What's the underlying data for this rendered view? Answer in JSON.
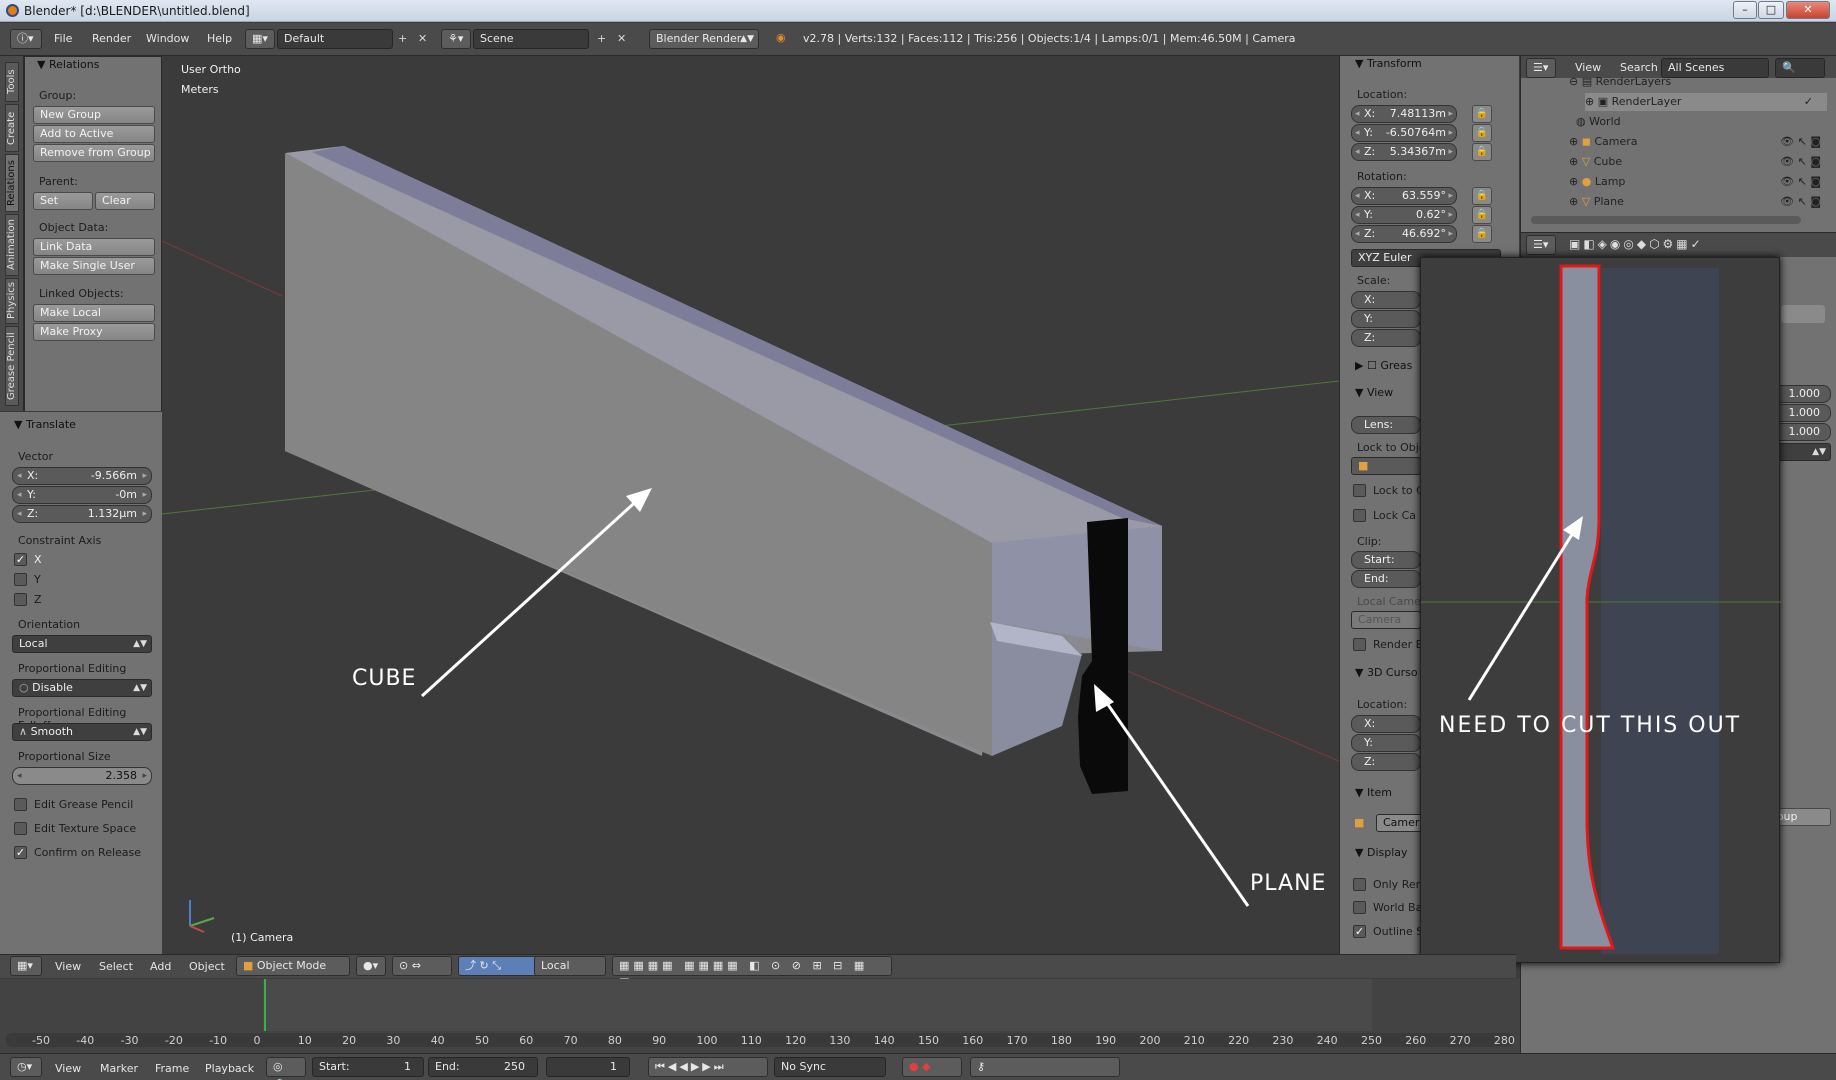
{
  "window": {
    "title": "Blender* [d:\\BLENDER\\untitled.blend]"
  },
  "topbar": {
    "menus": [
      "File",
      "Render",
      "Window",
      "Help"
    ],
    "layout": "Default",
    "scene": "Scene",
    "engine": "Blender Render",
    "stats": "v2.78 | Verts:132 | Faces:112 | Tris:256 | Objects:1/4 | Lamps:0/1 | Mem:46.50M | Camera"
  },
  "tool_tabs": [
    "Tools",
    "Create",
    "Relations",
    "Animation",
    "Physics",
    "Grease Pencil"
  ],
  "relations_panel": {
    "title": "Relations",
    "group_label": "Group:",
    "new_group": "New Group",
    "add_to_active": "Add to Active",
    "remove_from_group": "Remove from Group",
    "parent_label": "Parent:",
    "set": "Set",
    "clear": "Clear",
    "object_data_label": "Object Data:",
    "link_data": "Link Data",
    "make_single_user": "Make Single User",
    "linked_objects_label": "Linked Objects:",
    "make_local": "Make Local",
    "make_proxy": "Make Proxy"
  },
  "translate_panel": {
    "title": "Translate",
    "vector_label": "Vector",
    "x": "-9.566m",
    "y": "-0m",
    "z": "1.132µm",
    "constraint_label": "Constraint Axis",
    "axes": [
      "X",
      "Y",
      "Z"
    ],
    "orientation_label": "Orientation",
    "orientation": "Local",
    "prop_edit_label": "Proportional Editing",
    "prop_edit": "Disable",
    "falloff_label": "Proportional Editing Falloff",
    "falloff": "Smooth",
    "prop_size_label": "Proportional Size",
    "prop_size": "2.358",
    "edit_grease": "Edit Grease Pencil",
    "edit_texture": "Edit Texture Space",
    "confirm_release": "Confirm on Release"
  },
  "viewport": {
    "view_name": "User Ortho",
    "units": "Meters",
    "active_object": "(1) Camera",
    "annotations": {
      "cube": "CUBE",
      "plane": "PLANE",
      "cut": "NEED TO CUT THIS OUT"
    }
  },
  "transform_panel": {
    "title": "Transform",
    "location_label": "Location:",
    "loc_x": "7.48113m",
    "loc_y": "-6.50764m",
    "loc_z": "5.34367m",
    "rotation_label": "Rotation:",
    "rot_x": "63.559°",
    "rot_y": "0.62°",
    "rot_z": "46.692°",
    "rot_mode": "XYZ Euler",
    "scale_label": "Scale:",
    "axes": [
      "X:",
      "Y:",
      "Z:"
    ],
    "grease": "Greas",
    "view_title": "View",
    "lens": "Lens:",
    "lock_obj": "Lock to Obje",
    "lock_to": "Lock to C",
    "lock_cam": "Lock Ca",
    "clip": "Clip:",
    "start": "Start:",
    "end": "End:",
    "local_camera": "Local Came",
    "camera": "Camera",
    "render_border": "Render B",
    "cursor_title": "3D Curso",
    "cursor_location": "Location:",
    "item_title": "Item",
    "item_name": "Camer",
    "display_title": "Display",
    "only_render": "Only Ren",
    "world_bg": "World Ba",
    "outline": "Outline S"
  },
  "outliner": {
    "menus": [
      "View",
      "Search"
    ],
    "scope": "All Scenes",
    "rows": [
      {
        "label": "RenderLayers",
        "indent": 1
      },
      {
        "label": "RenderLayer",
        "indent": 2
      },
      {
        "label": "World",
        "indent": 1
      },
      {
        "label": "Camera",
        "indent": 1
      },
      {
        "label": "Cube",
        "indent": 1
      },
      {
        "label": "Lamp",
        "indent": 1
      },
      {
        "label": "Plane",
        "indent": 1
      }
    ]
  },
  "properties": {
    "values": [
      "1.000",
      "1.000",
      "1.000"
    ],
    "group": "Group"
  },
  "viewport_header": {
    "menus": [
      "View",
      "Select",
      "Add",
      "Object"
    ],
    "mode": "Object Mode",
    "orientation": "Local"
  },
  "timeline": {
    "ticks": [
      "-50",
      "-40",
      "-30",
      "-20",
      "-10",
      "0",
      "10",
      "20",
      "30",
      "40",
      "50",
      "60",
      "70",
      "80",
      "90",
      "100",
      "110",
      "120",
      "130",
      "140",
      "150",
      "160",
      "170",
      "180",
      "190",
      "200",
      "210",
      "220",
      "230",
      "240",
      "250",
      "260",
      "270",
      "280"
    ],
    "menus": [
      "View",
      "Marker",
      "Frame",
      "Playback"
    ],
    "start": "Start:",
    "start_val": "1",
    "end": "End:",
    "end_val": "250",
    "current": "1",
    "sync": "No Sync"
  }
}
